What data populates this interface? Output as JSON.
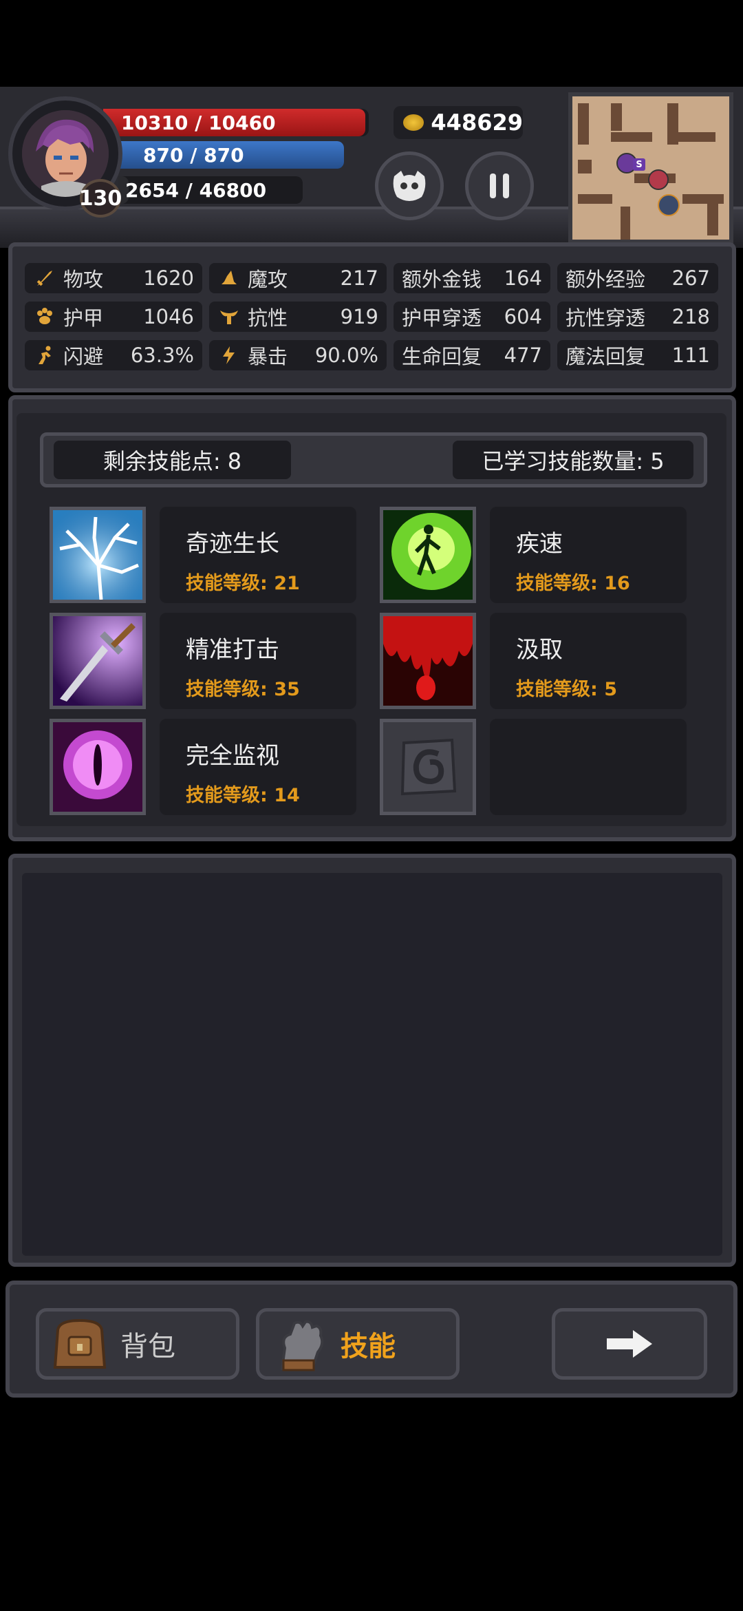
{
  "hud": {
    "level": "130",
    "hp_text": "10310 / 10460",
    "hp_fraction": 0.986,
    "mp_text": "870 / 870",
    "mp_fraction": 1.0,
    "xp_text": "2654 / 46800",
    "xp_fraction": 0.057,
    "gold": "448629",
    "minimap_marker": "S"
  },
  "stats": [
    {
      "icon": "sword-icon",
      "label": "物攻",
      "value": "1620"
    },
    {
      "icon": "magic-hat-icon",
      "label": "魔攻",
      "value": "217"
    },
    {
      "icon": "",
      "label": "额外金钱",
      "value": "164"
    },
    {
      "icon": "",
      "label": "额外经验",
      "value": "267"
    },
    {
      "icon": "paw-icon",
      "label": "护甲",
      "value": "1046"
    },
    {
      "icon": "horns-icon",
      "label": "抗性",
      "value": "919"
    },
    {
      "icon": "",
      "label": "护甲穿透",
      "value": "604"
    },
    {
      "icon": "",
      "label": "抗性穿透",
      "value": "218"
    },
    {
      "icon": "running-icon",
      "label": "闪避",
      "value": "63.3%"
    },
    {
      "icon": "lightning-icon",
      "label": "暴击",
      "value": "90.0%"
    },
    {
      "icon": "",
      "label": "生命回复",
      "value": "477"
    },
    {
      "icon": "",
      "label": "魔法回复",
      "value": "111"
    }
  ],
  "skills_header": {
    "remaining_points": "剩余技能点: 8",
    "learned_count": "已学习技能数量: 5"
  },
  "skills": [
    {
      "name": "奇迹生长",
      "level": "技能等级: 21",
      "icon": "lightning-tree-icon"
    },
    {
      "name": "疾速",
      "level": "技能等级: 16",
      "icon": "green-figure-icon"
    },
    {
      "name": "精准打击",
      "level": "技能等级: 35",
      "icon": "sword-skill-icon"
    },
    {
      "name": "汲取",
      "level": "技能等级: 5",
      "icon": "blood-drip-icon"
    },
    {
      "name": "完全监视",
      "level": "技能等级: 14",
      "icon": "eye-icon"
    }
  ],
  "nav": {
    "bag_label": "背包",
    "skill_label": "技能"
  }
}
